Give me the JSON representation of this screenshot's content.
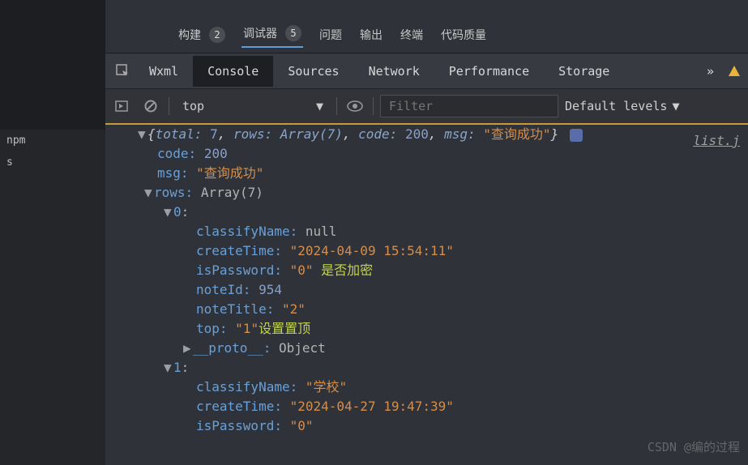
{
  "sidebar": {
    "items": [
      "npm",
      "s"
    ]
  },
  "topTabs": {
    "build": {
      "label": "构建",
      "count": "2"
    },
    "debugger": {
      "label": "调试器",
      "count": "5"
    },
    "issues": {
      "label": "问题"
    },
    "output": {
      "label": "输出"
    },
    "terminal": {
      "label": "终端"
    },
    "quality": {
      "label": "代码质量"
    }
  },
  "devtoolsTabs": {
    "wxml": "Wxml",
    "console": "Console",
    "sources": "Sources",
    "network": "Network",
    "performance": "Performance",
    "storage": "Storage",
    "more": "»"
  },
  "consoleBar": {
    "context": "top",
    "filterPlaceholder": "Filter",
    "levels": "Default levels"
  },
  "sourceLink": "list.j",
  "watermark": "CSDN @编的过程",
  "log": {
    "summary": {
      "totalKey": "total:",
      "totalVal": "7",
      "rowsKey": "rows:",
      "rowsVal": "Array(7)",
      "codeKey": "code:",
      "codeVal": "200",
      "msgKey": "msg:",
      "msgVal": "\"查询成功\""
    },
    "expanded": {
      "codeKey": "code:",
      "codeVal": "200",
      "msgKey": "msg:",
      "msgVal": "\"查询成功\"",
      "rowsKey": "rows:",
      "rowsVal": "Array(7)"
    },
    "item0": {
      "idx": "0",
      "classifyNameKey": "classifyName:",
      "classifyNameVal": "null",
      "createTimeKey": "createTime:",
      "createTimeVal": "\"2024-04-09 15:54:11\"",
      "isPasswordKey": "isPassword:",
      "isPasswordVal": "\"0\"",
      "isPasswordAnnot": "是否加密",
      "noteIdKey": "noteId:",
      "noteIdVal": "954",
      "noteTitleKey": "noteTitle:",
      "noteTitleVal": "\"2\"",
      "topKey": "top:",
      "topVal": "\"1\"",
      "topAnnot": "设置置顶",
      "protoKey": "__proto__:",
      "protoVal": "Object"
    },
    "item1": {
      "idx": "1",
      "classifyNameKey": "classifyName:",
      "classifyNameVal": "\"学校\"",
      "createTimeKey": "createTime:",
      "createTimeVal": "\"2024-04-27 19:47:39\"",
      "isPasswordKey": "isPassword:",
      "isPasswordVal": "\"0\""
    }
  }
}
